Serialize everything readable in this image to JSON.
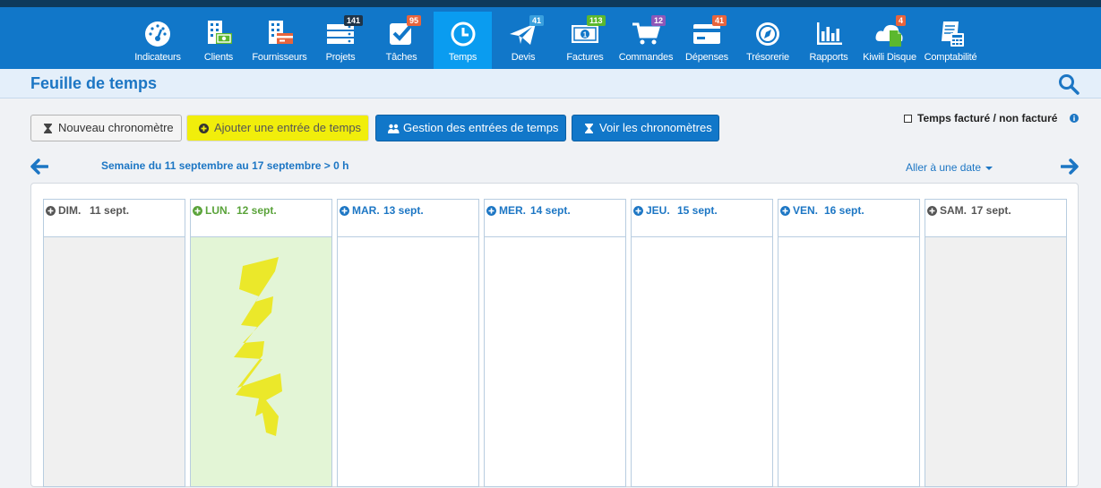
{
  "nav": {
    "items": [
      {
        "label": "Indicateurs",
        "badge": null
      },
      {
        "label": "Clients",
        "badge": null
      },
      {
        "label": "Fournisseurs",
        "badge": null
      },
      {
        "label": "Projets",
        "badge": "141"
      },
      {
        "label": "Tâches",
        "badge": "95"
      },
      {
        "label": "Temps",
        "badge": null,
        "active": true
      },
      {
        "label": "Devis",
        "badge": "41"
      },
      {
        "label": "Factures",
        "badge": "113"
      },
      {
        "label": "Commandes",
        "badge": "12"
      },
      {
        "label": "Dépenses",
        "badge": "41"
      },
      {
        "label": "Trésorerie",
        "badge": null
      },
      {
        "label": "Rapports",
        "badge": null
      },
      {
        "label": "Kiwili Disque",
        "badge": "4"
      },
      {
        "label": "Comptabilité",
        "badge": null
      }
    ],
    "badge_colors": {
      "projets": "#1f3448",
      "taches": "#e8643c",
      "devis": "#3aa0de",
      "factures": "#5cb82e",
      "commandes": "#8e57b8",
      "depenses": "#e8643c",
      "disque": "#e8643c"
    }
  },
  "page": {
    "title": "Feuille de temps"
  },
  "toolbar": {
    "new_timer": "Nouveau chronomètre",
    "add_entry": "Ajouter une entrée de temps",
    "manage_entries": "Gestion des entrées de temps",
    "view_timers": "Voir les chronomètres"
  },
  "billed_toggle": {
    "label": "Temps facturé / non facturé",
    "checked": false
  },
  "week": {
    "label": "Semaine du 11 septembre au 17 septembre > 0 h",
    "goto_date": "Aller à une date"
  },
  "days": [
    {
      "name": "DIM.",
      "date": "11 sept.",
      "type": "weekend"
    },
    {
      "name": "LUN.",
      "date": "12 sept.",
      "type": "today"
    },
    {
      "name": "MAR.",
      "date": "13 sept.",
      "type": "weekday"
    },
    {
      "name": "MER.",
      "date": "14 sept.",
      "type": "weekday"
    },
    {
      "name": "JEU.",
      "date": "15 sept.",
      "type": "weekday"
    },
    {
      "name": "VEN.",
      "date": "16 sept.",
      "type": "weekday"
    },
    {
      "name": "SAM.",
      "date": "17 sept.",
      "type": "weekend"
    }
  ],
  "colors": {
    "brand": "#1177c9",
    "active_tab": "#0a9cf0",
    "highlight": "#f1ee0b",
    "today_bg": "#e3f5d6",
    "weekend_bg": "#f0f0f0",
    "today_text": "#5aa33a",
    "weekend_text": "#555555",
    "weekday_text": "#1c76c4"
  }
}
